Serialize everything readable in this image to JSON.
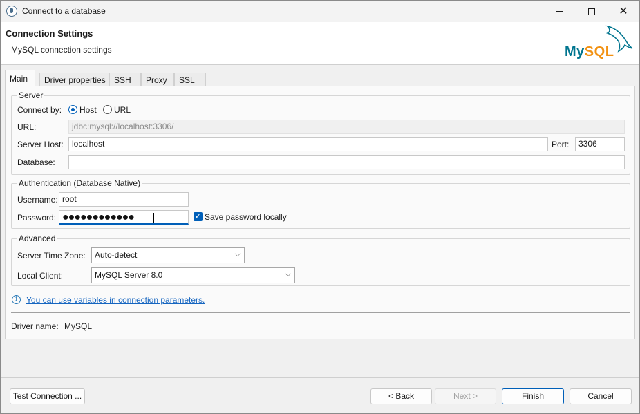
{
  "window": {
    "title": "Connect to a database",
    "close_glyph": "✕"
  },
  "header": {
    "title": "Connection Settings",
    "subtitle": "MySQL connection settings",
    "logo_my": "My",
    "logo_sql": "SQL"
  },
  "tabs": [
    {
      "label": "Main",
      "active": true
    },
    {
      "label": "Driver properties",
      "active": false
    },
    {
      "label": "SSH",
      "active": false
    },
    {
      "label": "Proxy",
      "active": false
    },
    {
      "label": "SSL",
      "active": false
    }
  ],
  "server": {
    "group_label": "Server",
    "connect_by_label": "Connect by:",
    "option_host": "Host",
    "option_url": "URL",
    "selected": "Host",
    "url_label": "URL:",
    "url_value": "jdbc:mysql://localhost:3306/",
    "host_label": "Server Host:",
    "host_value": "localhost",
    "port_label": "Port:",
    "port_value": "3306",
    "database_label": "Database:",
    "database_value": ""
  },
  "auth": {
    "group_label": "Authentication (Database Native)",
    "username_label": "Username:",
    "username_value": "root",
    "password_label": "Password:",
    "password_mask": "●●●●●●●●●●●●",
    "save_password_label": "Save password locally",
    "save_password_checked": true,
    "check_glyph": "✓"
  },
  "advanced": {
    "group_label": "Advanced",
    "timezone_label": "Server Time Zone:",
    "timezone_value": "Auto-detect",
    "client_label": "Local Client:",
    "client_value": "MySQL Server 8.0",
    "chevron_glyph": "⌵"
  },
  "info": {
    "icon_glyph": "i",
    "link_text": "You can use variables in connection parameters."
  },
  "driver": {
    "label": "Driver name:",
    "value": "MySQL"
  },
  "buttons": {
    "test_connection": "Test Connection ...",
    "back": "< Back",
    "next": "Next >",
    "finish": "Finish",
    "cancel": "Cancel"
  },
  "colors": {
    "accent": "#005fb8",
    "link": "#1565c0",
    "mysql_blue": "#00758f",
    "mysql_orange": "#f29111"
  }
}
